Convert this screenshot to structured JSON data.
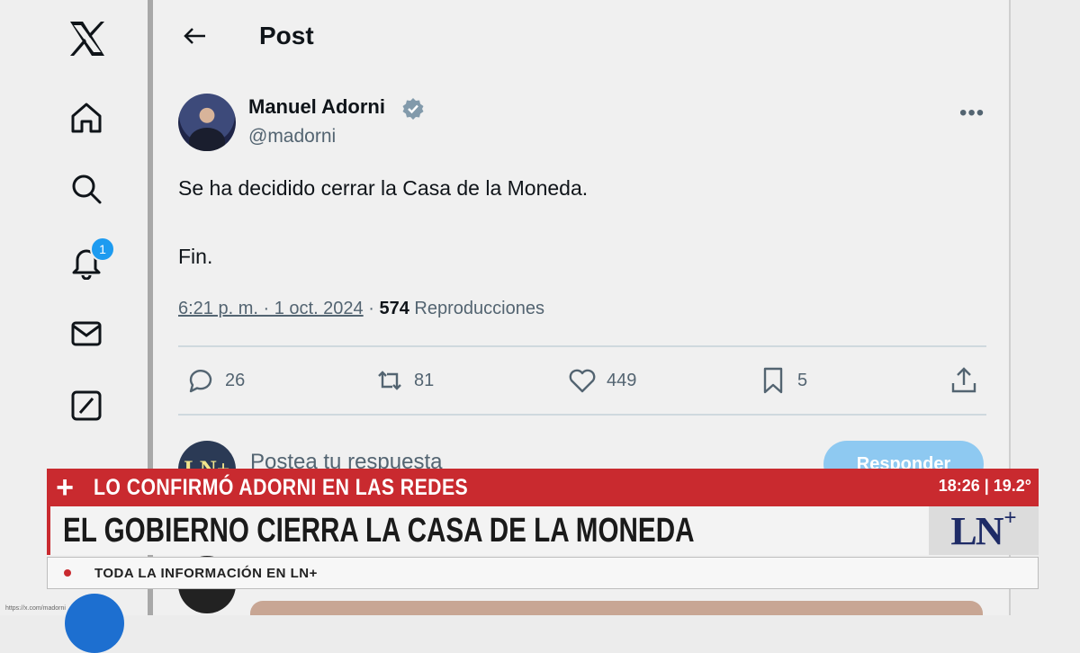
{
  "sidebar": {
    "logo_icon": "x-logo-icon",
    "items": [
      {
        "name": "home",
        "icon": "home-icon"
      },
      {
        "name": "explore",
        "icon": "search-icon"
      },
      {
        "name": "notifications",
        "icon": "bell-icon",
        "badge": "1"
      },
      {
        "name": "messages",
        "icon": "envelope-icon"
      },
      {
        "name": "grok",
        "icon": "grok-icon"
      }
    ]
  },
  "header": {
    "title": "Post"
  },
  "post": {
    "author_name": "Manuel Adorni",
    "handle": "@madorni",
    "text_line1": "Se ha decidido cerrar la Casa de la Moneda.",
    "text_line2": "Fin.",
    "timestamp": "6:21 p. m. · 1 oct. 2024",
    "separator": " · ",
    "views_count": "574",
    "views_label": "Reproducciones",
    "actions": {
      "replies": "26",
      "reposts": "81",
      "likes": "449",
      "bookmarks": "5"
    }
  },
  "reply_box": {
    "avatar_text": "LN+",
    "placeholder": "Postea tu respuesta",
    "button_label": "Responder"
  },
  "status_url": "https://x.com/madorni",
  "tv_overlay": {
    "plus": "+",
    "kicker": "LO CONFIRMÓ ADORNI EN LAS REDES",
    "time_temp": "18:26 | 19.2°",
    "headline": "EL GOBIERNO CIERRA LA CASA DE LA MONEDA",
    "logo_text": "LN",
    "logo_plus": "+",
    "ticker": "TODA LA INFORMACIÓN EN LN+"
  },
  "colors": {
    "accent_blue": "#1d9bf0",
    "reply_button": "#8ec9f1",
    "ln_red": "#c92a2f",
    "ln_navy": "#1e2b66"
  }
}
